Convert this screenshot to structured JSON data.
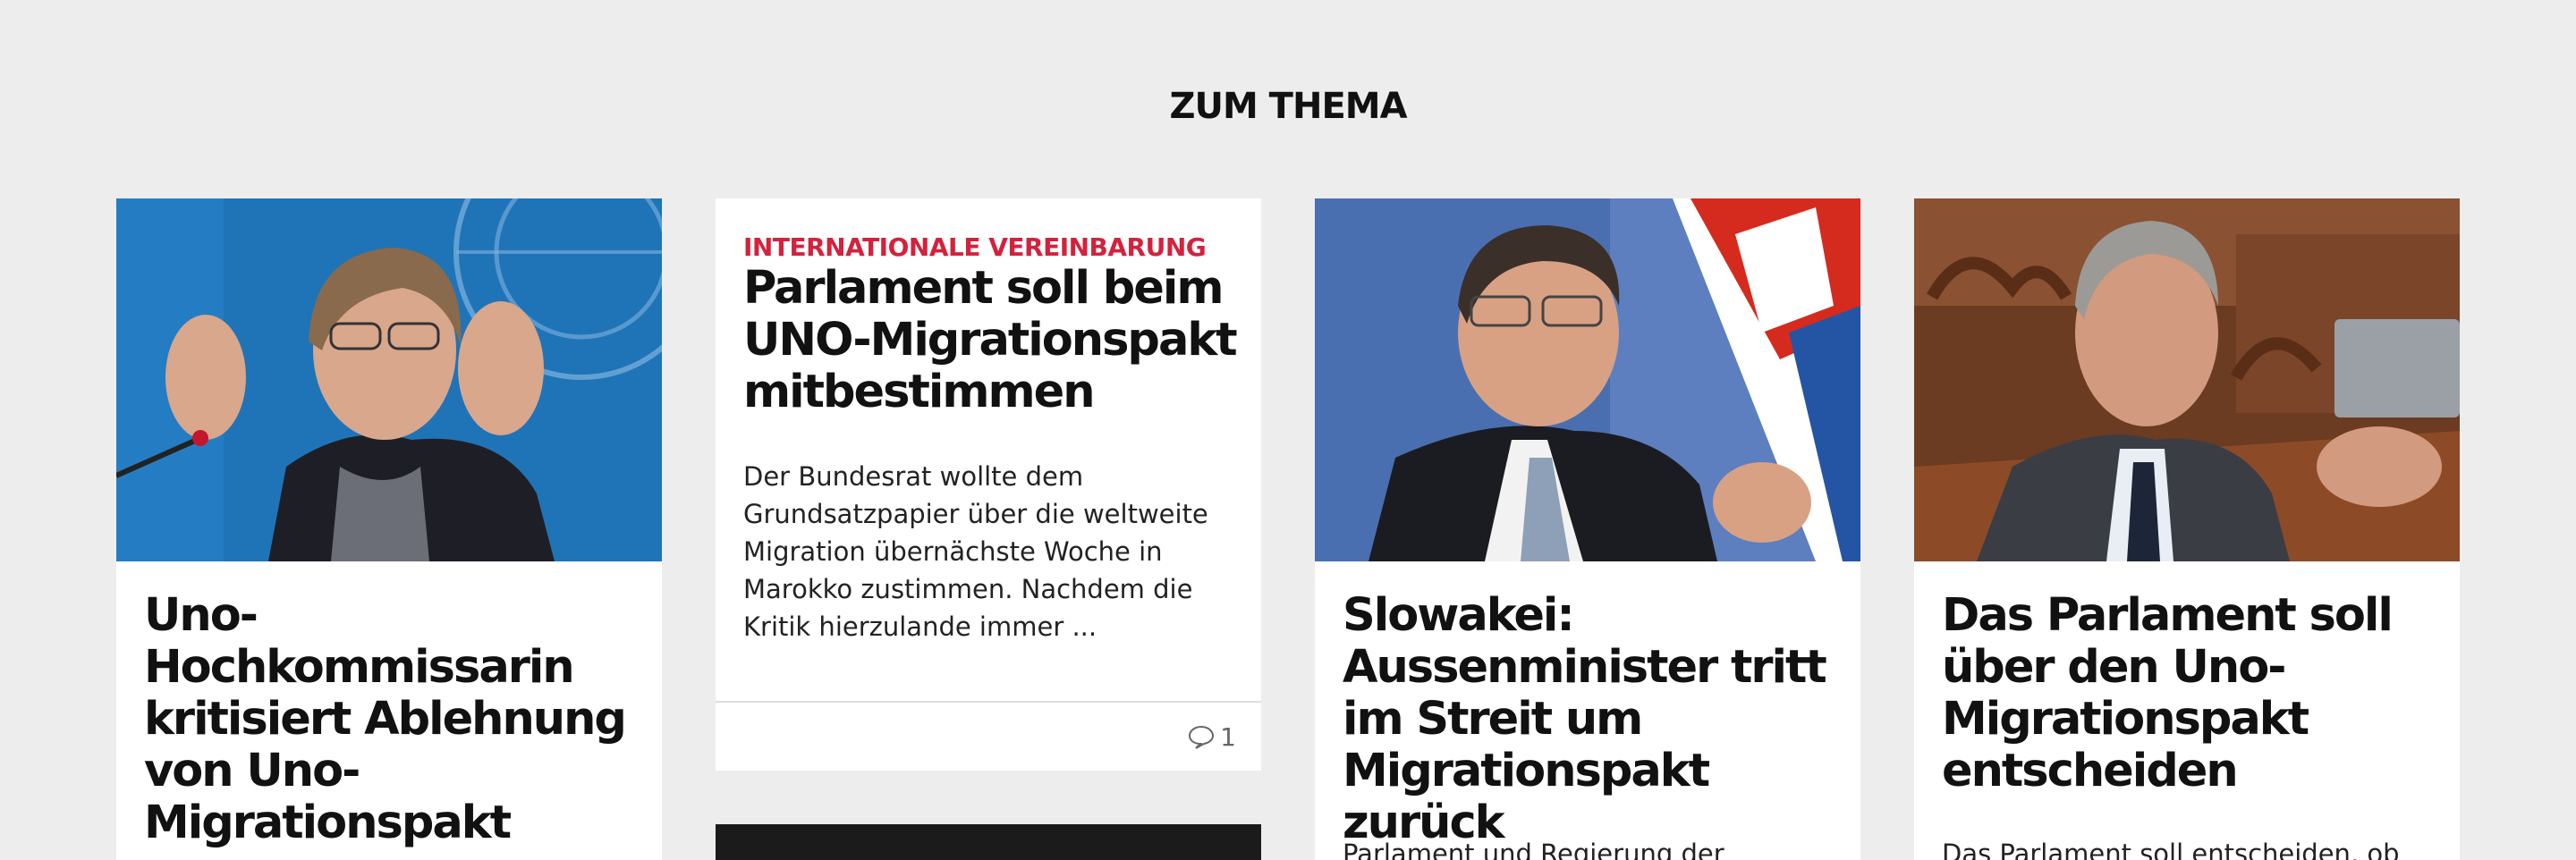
{
  "section": {
    "title": "ZUM THEMA"
  },
  "cards": [
    {
      "headline": "Uno-Hochkommissarin kritisiert Ablehnung von Uno-Migrationspakt",
      "image": "photo-woman-speaking-un"
    },
    {
      "kicker": "INTERNATIONALE VEREINBARUNG",
      "headline": "Parlament soll beim UNO-Migrationspakt mitbestimmen",
      "teaser": "Der Bundesrat wollte dem Grundsatzpapier über die weltweite Migration übernächste Woche in Marokko zustimmen. Nachdem die Kritik hierzulande immer ...",
      "comment_count": "1",
      "comment_icon": "speech-bubble-icon"
    },
    {
      "headline": "Slowakei: Aussenminister tritt im Streit um Migrationspakt zurück",
      "teaser": "Parlament und Regierung der",
      "image": "photo-man-slovak-flag"
    },
    {
      "headline": "Das Parlament soll über den Uno-Migrationspakt entscheiden",
      "teaser": "Das Parlament soll entscheiden, ob",
      "image": "photo-man-parliament"
    }
  ],
  "colors": {
    "background": "#ededed",
    "kicker": "#d4213d",
    "card": "#ffffff"
  }
}
